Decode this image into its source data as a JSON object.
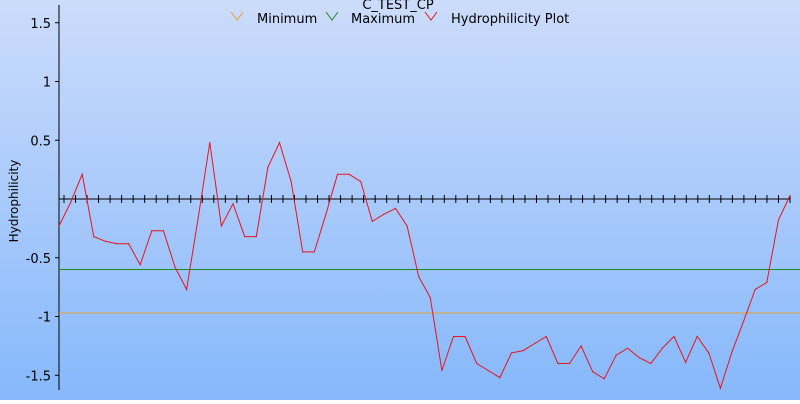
{
  "chart_data": {
    "type": "line",
    "title": "C_TEST_CP",
    "xlabel": "",
    "ylabel": "Hydrophilicity",
    "ylim": [
      -1.6,
      1.6
    ],
    "xlim": [
      0,
      63
    ],
    "y_ticks": [
      1.5,
      1,
      0.5,
      -0.5,
      -1,
      -1.5
    ],
    "y_tick_labels": [
      "1.5",
      "1",
      "0.5",
      "-0.5",
      "-1",
      "-1.5"
    ],
    "zero_axis_tick_count": 63,
    "grid": false,
    "legend_position": "top",
    "legend": [
      "Minimum",
      "Maximum",
      "Hydrophilicity Plot"
    ],
    "series": [
      {
        "name": "Minimum",
        "color": "#e8a030",
        "type": "hline",
        "value": -0.97
      },
      {
        "name": "Maximum",
        "color": "#1f8a1f",
        "type": "hline",
        "value": -0.6
      },
      {
        "name": "Hydrophilicity Plot",
        "color": "#e8141e",
        "x": [
          0,
          1,
          2,
          3,
          4,
          5,
          6,
          7,
          8,
          9,
          10,
          11,
          12,
          13,
          14,
          15,
          16,
          17,
          18,
          19,
          20,
          21,
          22,
          23,
          24,
          25,
          26,
          27,
          28,
          29,
          30,
          31,
          32,
          33,
          34,
          35,
          36,
          37,
          38,
          39,
          40,
          41,
          42,
          43,
          44,
          45,
          46,
          47,
          48,
          49,
          50,
          51,
          52,
          53,
          54,
          55,
          56,
          57,
          58,
          59,
          60,
          61,
          62,
          63
        ],
        "values": [
          -0.23,
          -0.03,
          0.21,
          -0.32,
          -0.36,
          -0.38,
          -0.38,
          -0.56,
          -0.27,
          -0.27,
          -0.58,
          -0.77,
          -0.16,
          0.48,
          -0.23,
          -0.04,
          -0.32,
          -0.32,
          0.27,
          0.48,
          0.15,
          -0.45,
          -0.45,
          -0.13,
          0.21,
          0.21,
          0.15,
          -0.19,
          -0.13,
          -0.08,
          -0.23,
          -0.66,
          -0.84,
          -1.46,
          -1.17,
          -1.17,
          -1.4,
          -1.46,
          -1.52,
          -1.31,
          -1.29,
          -1.23,
          -1.17,
          -1.4,
          -1.4,
          -1.25,
          -1.47,
          -1.53,
          -1.33,
          -1.27,
          -1.35,
          -1.4,
          -1.27,
          -1.17,
          -1.39,
          -1.17,
          -1.31,
          -1.61,
          -1.3,
          -1.04,
          -0.77,
          -0.71,
          -0.18,
          0.03
        ]
      }
    ]
  }
}
